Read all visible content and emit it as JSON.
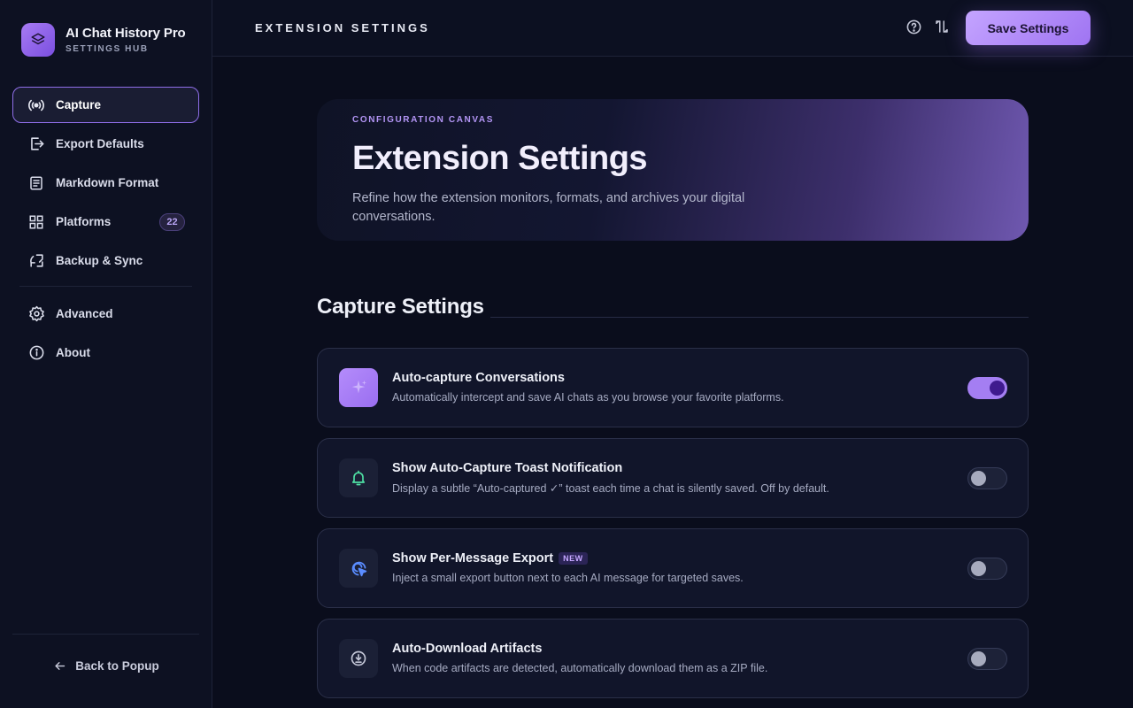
{
  "brand": {
    "title": "AI Chat History Pro",
    "subtitle": "SETTINGS HUB"
  },
  "sidebar": {
    "items": [
      {
        "label": "Capture",
        "icon": "broadcast-icon",
        "active": true
      },
      {
        "label": "Export Defaults",
        "icon": "export-icon"
      },
      {
        "label": "Markdown Format",
        "icon": "document-icon"
      },
      {
        "label": "Platforms",
        "icon": "grid-icon",
        "badge": "22"
      },
      {
        "label": "Backup & Sync",
        "icon": "sync-icon"
      },
      {
        "label": "Advanced",
        "icon": "gear-icon"
      },
      {
        "label": "About",
        "icon": "info-icon"
      }
    ],
    "back_label": "Back to Popup"
  },
  "header": {
    "title": "EXTENSION SETTINGS",
    "save_label": "Save Settings"
  },
  "hero": {
    "kicker": "CONFIGURATION CANVAS",
    "title": "Extension Settings",
    "description": "Refine how the extension monitors, formats, and archives your digital conversations."
  },
  "section": {
    "title": "Capture Settings"
  },
  "settings": [
    {
      "title": "Auto-capture Conversations",
      "description": "Automatically intercept and save AI chats as you browse your favorite platforms.",
      "icon": "sparkles-icon",
      "enabled": true
    },
    {
      "title": "Show Auto-Capture Toast Notification",
      "description": "Display a subtle “Auto-captured ✓” toast each time a chat is silently saved. Off by default.",
      "icon": "bell-icon",
      "enabled": false
    },
    {
      "title": "Show Per-Message Export",
      "badge": "NEW",
      "description": "Inject a small export button next to each AI message for targeted saves.",
      "icon": "cursor-click-icon",
      "enabled": false
    },
    {
      "title": "Auto-Download Artifacts",
      "description": "When code artifacts are detected, automatically download them as a ZIP file.",
      "icon": "download-icon",
      "enabled": false
    }
  ],
  "colors": {
    "accent": "#a47ef2",
    "background": "#0a0d1c",
    "sidebar": "#0d1122",
    "bell_green": "#4ee0a4",
    "cursor_blue": "#5a8cff"
  }
}
